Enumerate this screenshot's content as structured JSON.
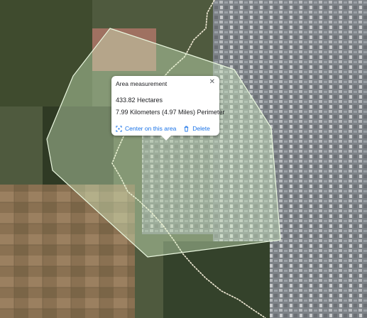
{
  "map": {
    "type": "satellite",
    "polygon_color": "#d6f5c8",
    "border_color": "#f3ecd8"
  },
  "popup": {
    "title": "Area measurement",
    "close_icon": "close-icon",
    "area": "433.82 Hectares",
    "perimeter": "7.99 Kilometers (4.97 Miles) Perimeter",
    "center_label": "Center on this area",
    "center_icon": "center-focus-icon",
    "delete_label": "Delete",
    "delete_icon": "trash-icon"
  }
}
